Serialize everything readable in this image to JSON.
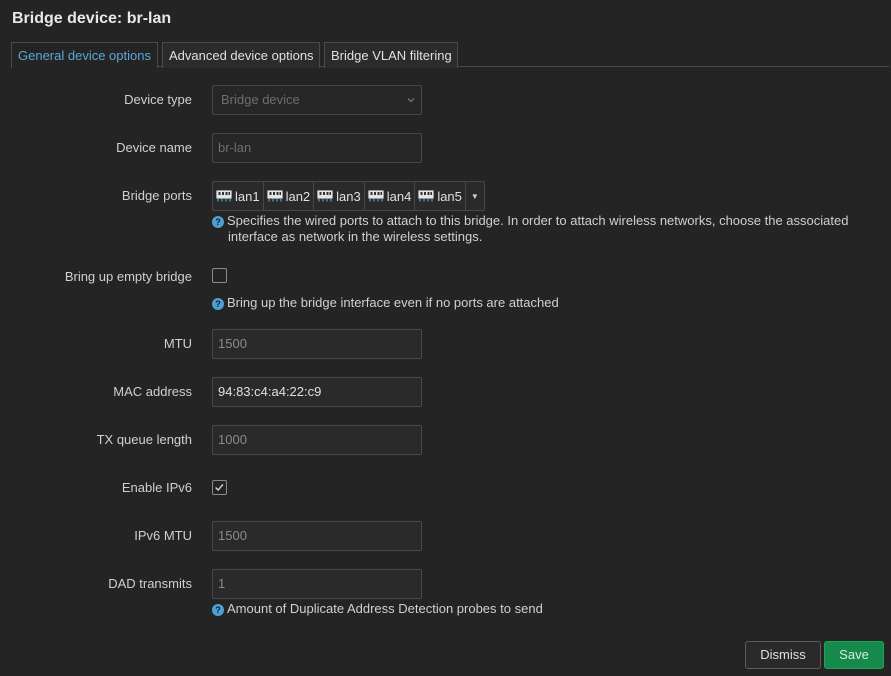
{
  "title": "Bridge device: br-lan",
  "tabs": [
    {
      "label": "General device options",
      "active": true
    },
    {
      "label": "Advanced device options",
      "active": false
    },
    {
      "label": "Bridge VLAN filtering",
      "active": false
    }
  ],
  "fields": {
    "device_type": {
      "label": "Device type",
      "value": "Bridge device"
    },
    "device_name": {
      "label": "Device name",
      "value": "br-lan"
    },
    "bridge_ports": {
      "label": "Bridge ports",
      "ports": [
        "lan1",
        "lan2",
        "lan3",
        "lan4",
        "lan5"
      ],
      "help": "Specifies the wired ports to attach to this bridge. In order to attach wireless networks, choose the associated",
      "help2": "interface as network in the wireless settings."
    },
    "empty_bridge": {
      "label": "Bring up empty bridge",
      "checked": false,
      "help": "Bring up the bridge interface even if no ports are attached"
    },
    "mtu": {
      "label": "MTU",
      "placeholder": "1500"
    },
    "mac": {
      "label": "MAC address",
      "value": "94:83:c4:a4:22:c9"
    },
    "txqueue": {
      "label": "TX queue length",
      "placeholder": "1000"
    },
    "ipv6": {
      "label": "Enable IPv6",
      "checked": true
    },
    "ipv6_mtu": {
      "label": "IPv6 MTU",
      "placeholder": "1500"
    },
    "dad": {
      "label": "DAD transmits",
      "placeholder": "1",
      "help": "Amount of Duplicate Address Detection probes to send"
    }
  },
  "buttons": {
    "dismiss": "Dismiss",
    "save": "Save"
  },
  "colors": {
    "accent": "#5aa7d9",
    "save": "#168a4a",
    "background": "#242424"
  },
  "icons": {
    "port": "ethernet-port-icon",
    "help": "help-icon",
    "chevron": "chevron-down-icon",
    "check": "check-icon"
  }
}
